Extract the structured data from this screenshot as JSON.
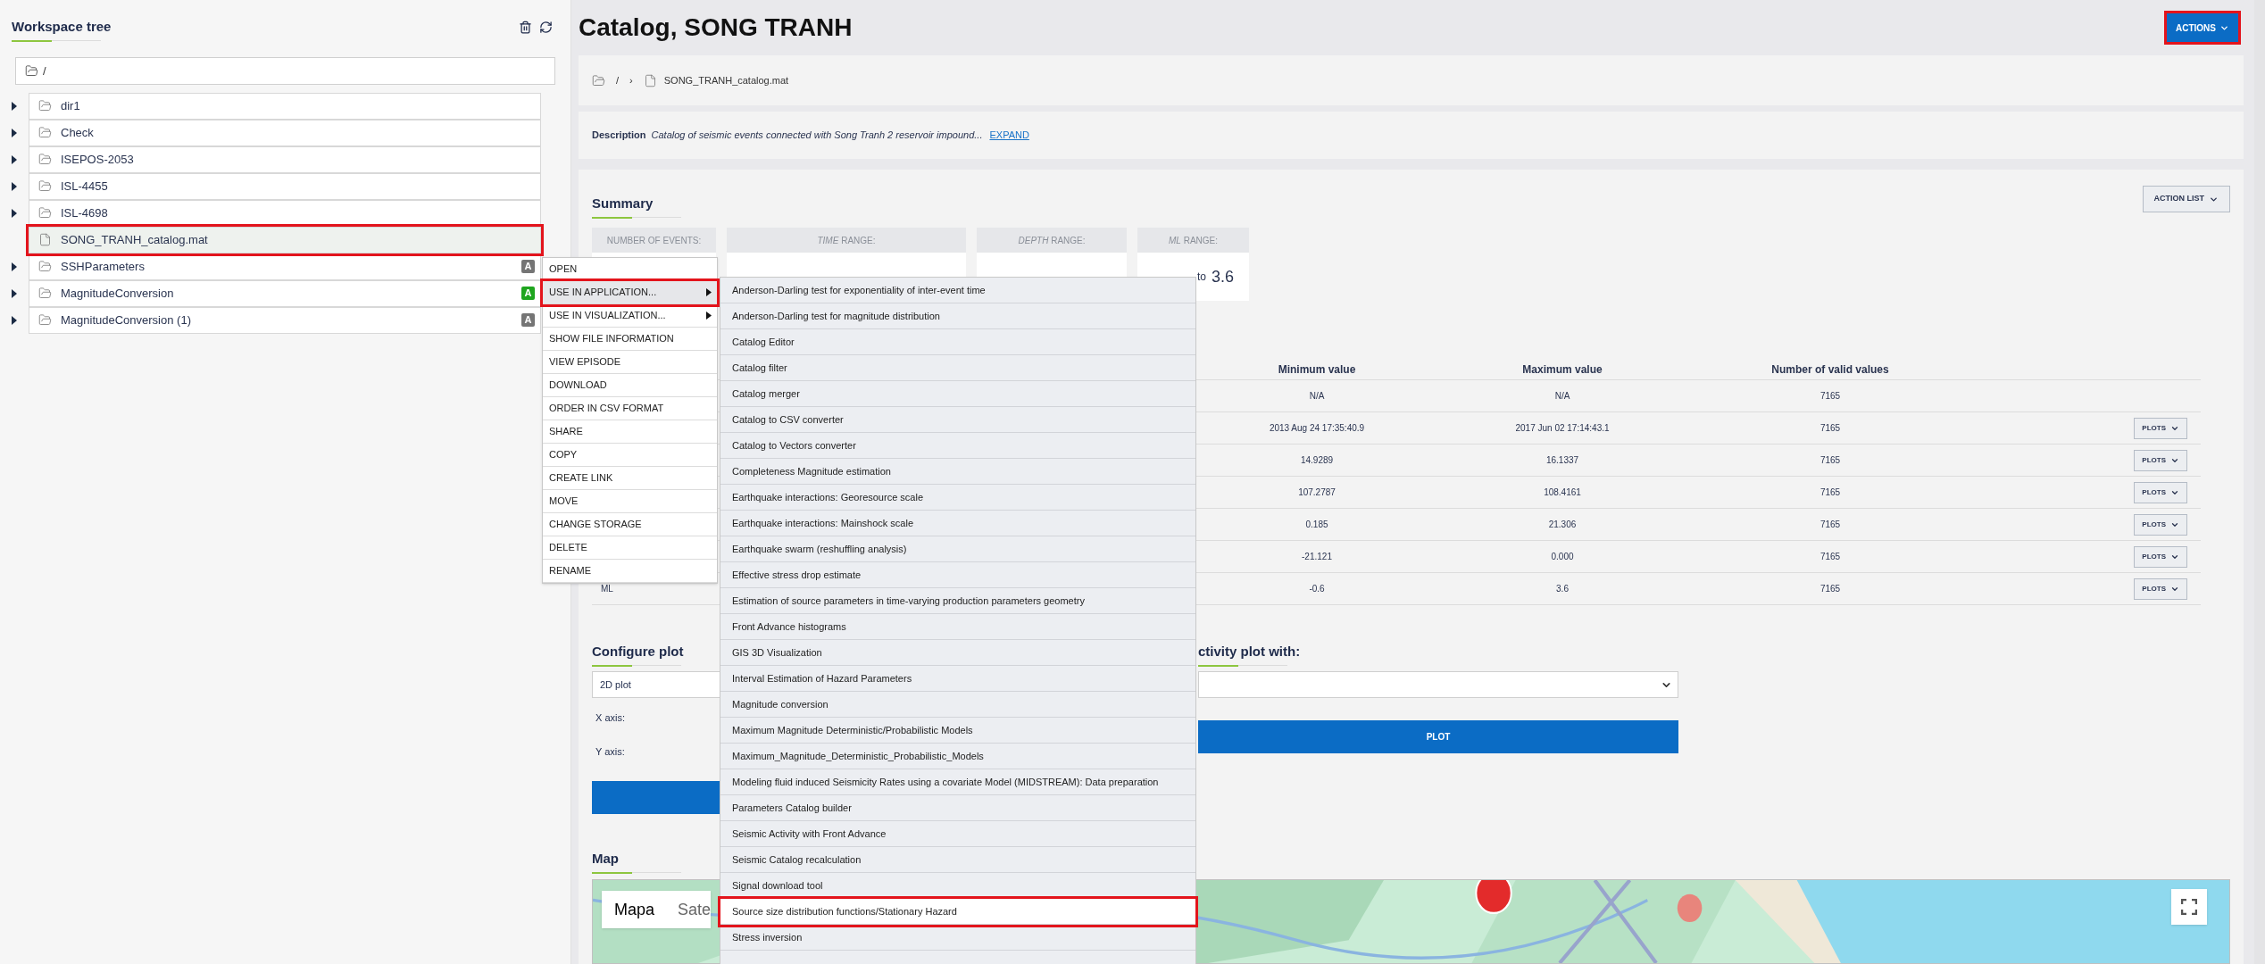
{
  "sidebar": {
    "title": "Workspace tree",
    "path": "/",
    "items": [
      {
        "kind": "folder",
        "name": "dir1",
        "expanded": false,
        "selected": false
      },
      {
        "kind": "folder",
        "name": "Check",
        "expanded": false,
        "selected": false
      },
      {
        "kind": "folder",
        "name": "ISEPOS-2053",
        "expanded": false,
        "selected": false
      },
      {
        "kind": "folder",
        "name": "ISL-4455",
        "expanded": false,
        "selected": false
      },
      {
        "kind": "folder",
        "name": "ISL-4698",
        "expanded": false,
        "selected": false
      },
      {
        "kind": "file",
        "name": "SONG_TRANH_catalog.mat",
        "selected": true
      },
      {
        "kind": "folder",
        "name": "SSHParameters",
        "expanded": false,
        "selected": false,
        "badge": {
          "text": "A",
          "color": "#757575"
        }
      },
      {
        "kind": "folder",
        "name": "MagnitudeConversion",
        "expanded": false,
        "selected": false,
        "badge": {
          "text": "A",
          "color": "#1fa51f"
        }
      },
      {
        "kind": "folder",
        "name": "MagnitudeConversion (1)",
        "expanded": false,
        "selected": false,
        "badge": {
          "text": "A",
          "color": "#757575"
        }
      }
    ]
  },
  "context_menu": {
    "items": [
      {
        "label": "OPEN",
        "highlighted": false,
        "submenu": false
      },
      {
        "label": "USE IN APPLICATION...",
        "highlighted": true,
        "submenu": true
      },
      {
        "label": "USE IN VISUALIZATION...",
        "highlighted": false,
        "submenu": true
      },
      {
        "label": "SHOW FILE INFORMATION",
        "highlighted": false,
        "submenu": false
      },
      {
        "label": "VIEW EPISODE",
        "highlighted": false,
        "submenu": false
      },
      {
        "label": "DOWNLOAD",
        "highlighted": false,
        "submenu": false
      },
      {
        "label": "ORDER IN CSV FORMAT",
        "highlighted": false,
        "submenu": false
      },
      {
        "label": "SHARE",
        "highlighted": false,
        "submenu": false
      },
      {
        "label": "COPY",
        "highlighted": false,
        "submenu": false
      },
      {
        "label": "CREATE LINK",
        "highlighted": false,
        "submenu": false
      },
      {
        "label": "MOVE",
        "highlighted": false,
        "submenu": false
      },
      {
        "label": "CHANGE STORAGE",
        "highlighted": false,
        "submenu": false
      },
      {
        "label": "DELETE",
        "highlighted": false,
        "submenu": false
      },
      {
        "label": "RENAME",
        "highlighted": false,
        "submenu": false
      }
    ]
  },
  "submenu": {
    "items": [
      {
        "label": "Anderson-Darling test for exponentiality of inter-event time",
        "highlighted": false
      },
      {
        "label": "Anderson-Darling test for magnitude distribution",
        "highlighted": false
      },
      {
        "label": "Catalog Editor",
        "highlighted": false
      },
      {
        "label": "Catalog filter",
        "highlighted": false
      },
      {
        "label": "Catalog merger",
        "highlighted": false
      },
      {
        "label": "Catalog to CSV converter",
        "highlighted": false
      },
      {
        "label": "Catalog to Vectors converter",
        "highlighted": false
      },
      {
        "label": "Completeness Magnitude estimation",
        "highlighted": false
      },
      {
        "label": "Earthquake interactions: Georesource scale",
        "highlighted": false
      },
      {
        "label": "Earthquake interactions: Mainshock scale",
        "highlighted": false
      },
      {
        "label": "Earthquake swarm (reshuffling analysis)",
        "highlighted": false
      },
      {
        "label": "Effective stress drop estimate",
        "highlighted": false
      },
      {
        "label": "Estimation of source parameters in time-varying production parameters geometry",
        "highlighted": false
      },
      {
        "label": "Front Advance histograms",
        "highlighted": false
      },
      {
        "label": "GIS 3D Visualization",
        "highlighted": false
      },
      {
        "label": "Interval Estimation of Hazard Parameters",
        "highlighted": false
      },
      {
        "label": "Magnitude conversion",
        "highlighted": false
      },
      {
        "label": "Maximum Magnitude Deterministic/Probabilistic Models",
        "highlighted": false
      },
      {
        "label": "Maximum_Magnitude_Deterministic_Probabilistic_Models",
        "highlighted": false
      },
      {
        "label": "Modeling fluid induced Seismicity Rates using a covariate Model (MIDSTREAM): Data preparation",
        "highlighted": false
      },
      {
        "label": "Parameters Catalog builder",
        "highlighted": false
      },
      {
        "label": "Seismic Activity with Front Advance",
        "highlighted": false
      },
      {
        "label": "Seismic Catalog recalculation",
        "highlighted": false
      },
      {
        "label": "Signal download tool",
        "highlighted": false
      },
      {
        "label": "Source size distribution functions/Stationary Hazard",
        "highlighted": true
      },
      {
        "label": "Stress inversion",
        "highlighted": false
      }
    ]
  },
  "page": {
    "title": "Catalog, SONG TRANH",
    "actions": {
      "label": "ACTIONS",
      "highlighted": true
    }
  },
  "breadcrumb": {
    "root": "/",
    "separator": "›",
    "file": "SONG_TRANH_catalog.mat"
  },
  "description": {
    "label": "Description",
    "text": "Catalog of seismic events connected with Song Tranh 2 reservoir impound...",
    "link": "EXPAND"
  },
  "summary": {
    "title": "Summary",
    "action_list": "ACTION LIST",
    "stats": [
      {
        "label": "NUMBER OF EVENTS:"
      },
      {
        "label": "*TIME* RANGE:"
      },
      {
        "label": "*DEPTH* RANGE:"
      },
      {
        "label": "*ML* RANGE:",
        "connector": "to",
        "max": "3.6"
      }
    ]
  },
  "table": {
    "columns": [
      "Minimum value",
      "Maximum value",
      "Number of valid values"
    ],
    "rows": [
      {
        "min": "N/A",
        "max": "N/A",
        "valid": "7165"
      },
      {
        "min": "2013 Aug 24 17:35:40.9",
        "max": "2017 Jun 02 17:14:43.1",
        "valid": "7165",
        "plots": "PLOTS"
      },
      {
        "min": "14.9289",
        "max": "16.1337",
        "valid": "7165",
        "plots": "PLOTS"
      },
      {
        "min": "107.2787",
        "max": "108.4161",
        "valid": "7165",
        "plots": "PLOTS"
      },
      {
        "min": "0.185",
        "max": "21.306",
        "valid": "7165",
        "plots": "PLOTS"
      },
      {
        "min": "-21.121",
        "max": "0.000",
        "valid": "7165",
        "plots": "PLOTS"
      },
      {
        "label": "ML",
        "min": "-0.6",
        "max": "3.6",
        "valid": "7165",
        "plots": "PLOTS"
      }
    ]
  },
  "configure_plot": {
    "title": "Configure plot",
    "plot_type": "2D plot",
    "x_label": "X axis:",
    "y_label": "Y axis:"
  },
  "activity_plot": {
    "title": "ctivity plot with:",
    "button": "PLOT"
  },
  "map": {
    "title": "Map",
    "map_type_tabs": [
      {
        "label": "Mapa",
        "selected": true
      },
      {
        "label": "Sate",
        "selected": false
      }
    ]
  }
}
